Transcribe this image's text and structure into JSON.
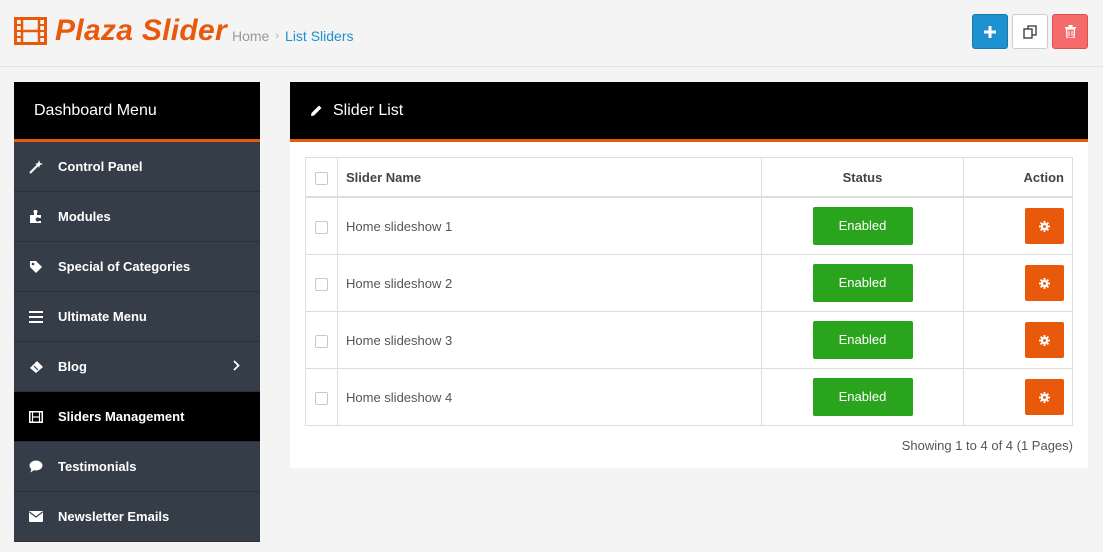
{
  "header": {
    "logo_text": "Plaza Slider",
    "logo_icon": "film-icon",
    "breadcrumb": {
      "home": "Home",
      "separator": "›",
      "current": "List Sliders"
    },
    "buttons": [
      {
        "name": "add-button",
        "icon": "plus-icon",
        "color": "#1e91cf"
      },
      {
        "name": "copy-button",
        "icon": "copy-icon",
        "color": "#ffffff"
      },
      {
        "name": "delete-button",
        "icon": "trash-icon",
        "color": "#f56b6b"
      }
    ]
  },
  "sidebar": {
    "title": "Dashboard Menu",
    "items": [
      {
        "label": "Control Panel",
        "icon": "magic-wand-icon",
        "active": false
      },
      {
        "label": "Modules",
        "icon": "puzzle-icon",
        "active": false
      },
      {
        "label": "Special of Categories",
        "icon": "tag-icon",
        "active": false
      },
      {
        "label": "Ultimate Menu",
        "icon": "list-icon",
        "active": false
      },
      {
        "label": "Blog",
        "icon": "ticket-icon",
        "active": false,
        "has_submenu": true
      },
      {
        "label": "Sliders Management",
        "icon": "film-icon",
        "active": true
      },
      {
        "label": "Testimonials",
        "icon": "comment-icon",
        "active": false
      },
      {
        "label": "Newsletter Emails",
        "icon": "envelope-icon",
        "active": false
      }
    ]
  },
  "main": {
    "title": "Slider List",
    "title_icon": "pencil-icon",
    "table": {
      "columns": [
        "Slider Name",
        "Status",
        "Action"
      ],
      "rows": [
        {
          "name": "Home slideshow 1",
          "status": "Enabled"
        },
        {
          "name": "Home slideshow 2",
          "status": "Enabled"
        },
        {
          "name": "Home slideshow 3",
          "status": "Enabled"
        },
        {
          "name": "Home slideshow 4",
          "status": "Enabled"
        }
      ]
    },
    "pagination_info": "Showing 1 to 4 of 4 (1 Pages)"
  },
  "colors": {
    "accent": "#e8590c",
    "primary": "#1e91cf",
    "danger": "#f56b6b",
    "success": "#2ba41d",
    "sidebar_bg": "#353e48"
  }
}
